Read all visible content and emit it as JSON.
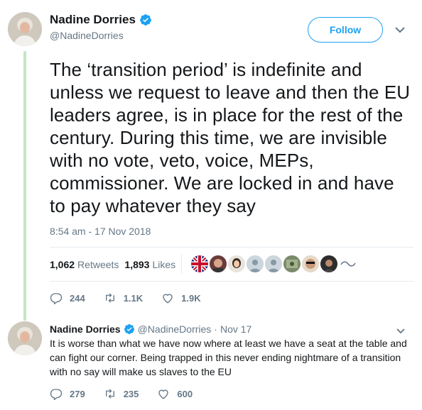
{
  "main_tweet": {
    "author": {
      "name": "Nadine Dorries",
      "handle": "@NadineDorries",
      "verified": true
    },
    "follow_label": "Follow",
    "text": "The ‘transition period’ is indefinite and unless we request to leave and then the EU leaders agree, is in place for the rest of the century. During this time, we are invisible with no vote, veto, voice, MEPs, commissioner. We are locked in and have to pay whatever they say",
    "timestamp": "8:54 am - 17 Nov 2018",
    "retweets": {
      "count": "1,062",
      "label": "Retweets"
    },
    "likes": {
      "count": "1,893",
      "label": "Likes"
    },
    "actions": {
      "replies": "244",
      "retweets": "1.1K",
      "likes": "1.9K"
    }
  },
  "reply_tweet": {
    "author": {
      "name": "Nadine Dorries",
      "handle": "@NadineDorries",
      "verified": true
    },
    "date": "Nov 17",
    "separator": "·",
    "text": "It is worse than what we have now where at least we have a seat at the table and can fight our corner. Being trapped in this never ending nightmare of a transition with no say will make us slaves to the EU",
    "actions": {
      "replies": "279",
      "retweets": "235",
      "likes": "600"
    }
  },
  "colors": {
    "accent": "#1da1f2",
    "thread_line": "#c4e6c6",
    "muted": "#657786"
  }
}
